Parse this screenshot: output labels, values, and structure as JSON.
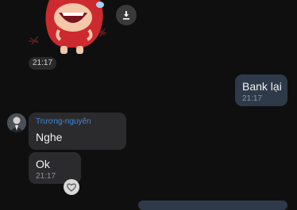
{
  "sticker": {
    "icon": "red-cartoon-sticker",
    "time": "21:17"
  },
  "download": {
    "icon": "download-icon"
  },
  "outgoing": [
    {
      "text": "Bank lại",
      "time": "21:17"
    }
  ],
  "incoming": [
    {
      "sender": "Trương-nguyên",
      "text": "Nghe"
    },
    {
      "text": "Ok",
      "time": "21:17"
    }
  ],
  "reaction": {
    "icon": "heart-icon"
  },
  "colors": {
    "background": "#0f0f0f",
    "incoming_bubble": "#2b2b2d",
    "outgoing_bubble": "#2e3a4a",
    "sender_name": "#3c8bd6"
  }
}
